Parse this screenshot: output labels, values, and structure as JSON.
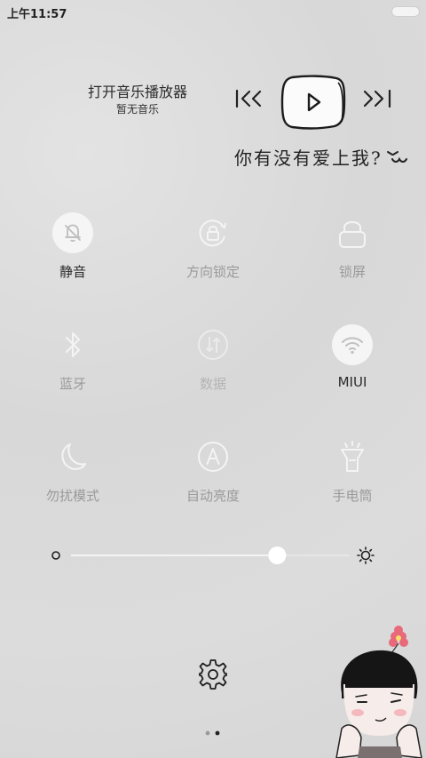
{
  "status_bar": {
    "time": "上午11:57"
  },
  "music": {
    "title": "打开音乐播放器",
    "subtitle": "暂无音乐",
    "slogan": "你有没有爱上我?",
    "controls": [
      "previous-icon",
      "play-icon",
      "next-icon"
    ]
  },
  "toggles": {
    "mute": {
      "label": "静音",
      "icon": "bell-off-icon",
      "state": "on"
    },
    "rotation_lock": {
      "label": "方向锁定",
      "icon": "rotation-lock-icon",
      "state": "off"
    },
    "lock_screen": {
      "label": "锁屏",
      "icon": "lock-icon",
      "state": "off"
    },
    "bluetooth": {
      "label": "蓝牙",
      "icon": "bluetooth-icon",
      "state": "off"
    },
    "mobile_data": {
      "label": "数据",
      "icon": "data-icon",
      "state": "disabled"
    },
    "wifi": {
      "label": "MIUI",
      "icon": "wifi-icon",
      "state": "on"
    },
    "do_not_disturb": {
      "label": "勿扰模式",
      "icon": "moon-icon",
      "state": "off"
    },
    "auto_brightness": {
      "label": "自动亮度",
      "icon": "auto-brightness-icon",
      "state": "off"
    },
    "flashlight": {
      "label": "手电筒",
      "icon": "flashlight-icon",
      "state": "off"
    }
  },
  "brightness": {
    "level": 0.74
  },
  "pager": {
    "count": 2,
    "active": 1
  },
  "colors": {
    "active_tile_bg": "#f5f5f5",
    "inactive_label": "#9a9a9a",
    "active_label": "#2b2b2b"
  }
}
